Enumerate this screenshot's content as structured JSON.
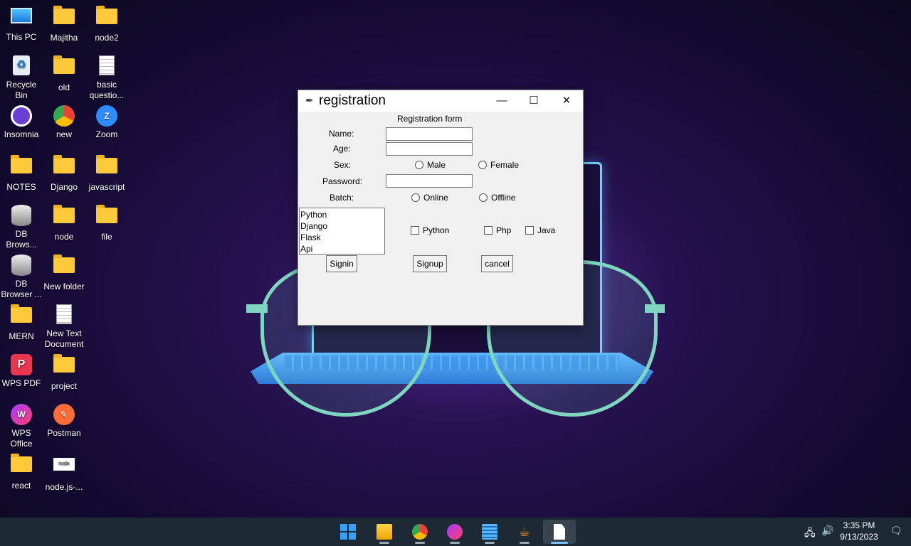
{
  "desktop": {
    "icons": [
      {
        "label": "This PC",
        "icon": "monitor-icon"
      },
      {
        "label": "Majitha",
        "icon": "folder-icon"
      },
      {
        "label": "node2",
        "icon": "folder-icon"
      },
      {
        "label": "Recycle Bin",
        "icon": "recycle-bin-icon"
      },
      {
        "label": "old",
        "icon": "folder-icon"
      },
      {
        "label": "basic questio...",
        "icon": "document-icon"
      },
      {
        "label": "Insomnia",
        "icon": "insomnia-icon"
      },
      {
        "label": "new",
        "icon": "chrome-icon"
      },
      {
        "label": "Zoom",
        "icon": "zoom-icon"
      },
      {
        "label": "NOTES",
        "icon": "folder-icon"
      },
      {
        "label": "Django",
        "icon": "folder-icon"
      },
      {
        "label": "javascript",
        "icon": "folder-icon"
      },
      {
        "label": "DB Brows...",
        "icon": "database-icon"
      },
      {
        "label": "node",
        "icon": "folder-icon"
      },
      {
        "label": "file",
        "icon": "folder-icon"
      },
      {
        "label": "DB Browser ...",
        "icon": "database-icon"
      },
      {
        "label": "New folder",
        "icon": "folder-icon"
      },
      {
        "label": "MERN",
        "icon": "folder-icon"
      },
      {
        "label": "New Text Document",
        "icon": "text-document-icon"
      },
      {
        "label": "WPS PDF",
        "icon": "wps-pdf-icon"
      },
      {
        "label": "project",
        "icon": "folder-icon"
      },
      {
        "label": "WPS Office",
        "icon": "wps-office-icon"
      },
      {
        "label": "Postman",
        "icon": "postman-icon"
      },
      {
        "label": "react",
        "icon": "folder-icon"
      },
      {
        "label": "node.js-...",
        "icon": "nodejs-image-icon"
      }
    ]
  },
  "window": {
    "title": "registration",
    "minimize": "—",
    "maximize": "☐",
    "close": "✕",
    "heading": "Registration form",
    "name_label": "Name:",
    "age_label": "Age:",
    "sex_label": "Sex:",
    "sex_options": [
      "Male",
      "Female"
    ],
    "password_label": "Password:",
    "batch_label": "Batch:",
    "batch_options": [
      "Online",
      "Offline"
    ],
    "listbox_items": [
      "Python",
      "Django",
      "Flask",
      "Api"
    ],
    "checkbox_options": [
      "Python",
      "Php",
      "Java"
    ],
    "buttons": {
      "signin": "Signin",
      "signup": "Signup",
      "cancel": "cancel"
    },
    "name_value": "",
    "age_value": "",
    "password_value": ""
  },
  "taskbar": {
    "apps": [
      "start-icon",
      "file-explorer-icon",
      "chrome-icon",
      "wps-office-icon",
      "notepad-icon",
      "java-icon",
      "file-icon"
    ],
    "time": "3:35 PM",
    "date": "9/13/2023"
  },
  "colors": {
    "folder": "#ffc93c",
    "taskbar": "#1d2a36",
    "window_bg": "#f0f0f0"
  }
}
